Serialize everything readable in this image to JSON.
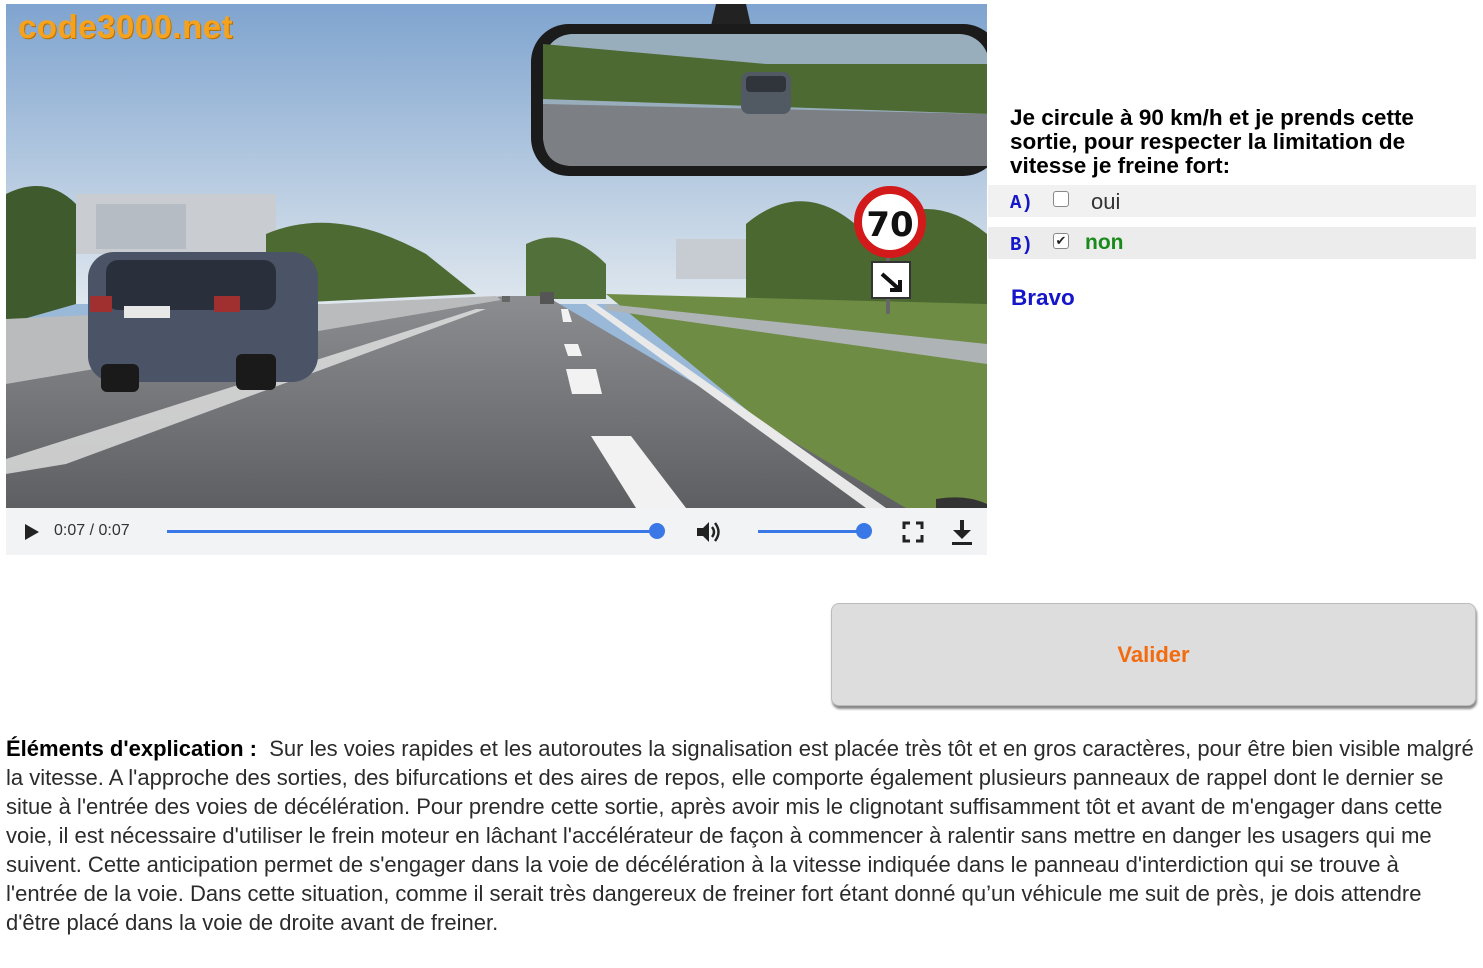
{
  "video": {
    "watermark": "code3000.net",
    "sign_speed": "70",
    "time_display": "0:07 / 0:07",
    "progress": 1.0,
    "volume": 1.0,
    "icons": [
      "play-icon",
      "volume-icon",
      "fullscreen-icon",
      "download-icon"
    ]
  },
  "question": {
    "text": "Je circule à 90 km/h et je prends cette sortie, pour respecter la limitation de vitesse je freine fort:",
    "answers": [
      {
        "letter": "A)",
        "label": "oui",
        "checked": false
      },
      {
        "letter": "B)",
        "label": "non",
        "checked": true
      }
    ],
    "result": "Bravo",
    "result_color": "#1515c9"
  },
  "submit": {
    "label": "Valider",
    "label_color": "#f26b0f"
  },
  "explanation": {
    "title": "Éléments d'explication :",
    "body": "Sur les voies rapides et les autoroutes la signalisation est placée très tôt et en gros caractères, pour être bien visible malgré la vitesse. A l'approche des sorties, des bifurcations et des aires de repos, elle comporte également plusieurs panneaux de rappel dont le dernier se situe à l'entrée des voies de décélération. Pour prendre cette sortie, après avoir mis le clignotant suffisamment tôt et avant de m'engager dans cette voie, il est nécessaire d'utiliser le frein moteur en lâchant l'accélérateur de façon à commencer à ralentir sans mettre en danger les usagers qui me suivent. Cette anticipation permet de s'engager dans la voie de décélération à la vitesse indiquée dans le panneau d'interdiction qui se trouve à l'entrée de la voie. Dans cette situation, comme il serait très dangereux de freiner fort étant donné qu’un véhicule me suit de près, je dois attendre d'être placé dans la voie de droite avant de freiner."
  }
}
